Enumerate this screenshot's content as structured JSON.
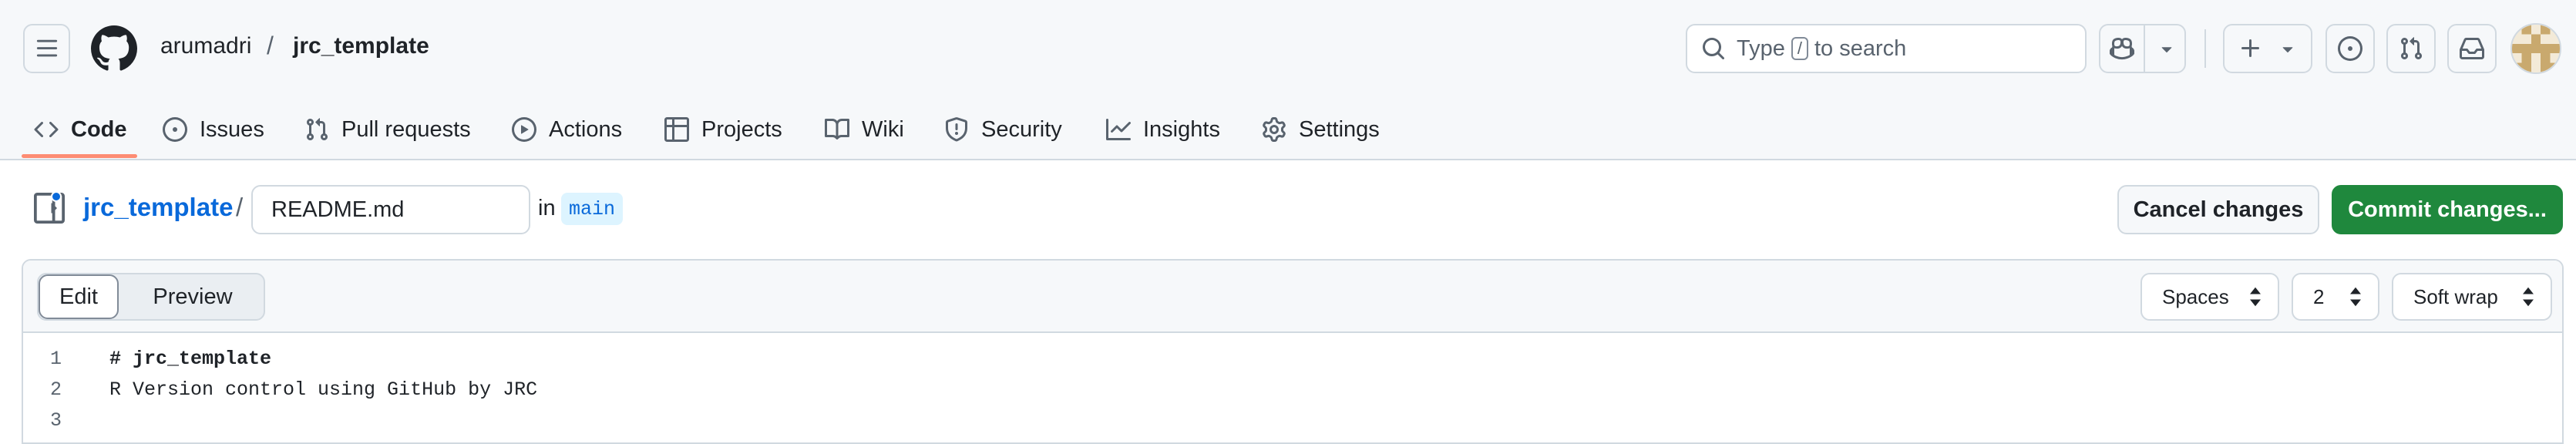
{
  "header": {
    "owner": "arumadri",
    "separator": "/",
    "repo": "jrc_template",
    "search": {
      "prefix": "Type",
      "shortcut_key": "/",
      "suffix": "to search"
    }
  },
  "tabs": [
    {
      "label": "Code",
      "icon": "code-icon"
    },
    {
      "label": "Issues",
      "icon": "issue-opened-icon"
    },
    {
      "label": "Pull requests",
      "icon": "git-pull-request-icon"
    },
    {
      "label": "Actions",
      "icon": "play-icon"
    },
    {
      "label": "Projects",
      "icon": "table-icon"
    },
    {
      "label": "Wiki",
      "icon": "book-icon"
    },
    {
      "label": "Security",
      "icon": "shield-icon"
    },
    {
      "label": "Insights",
      "icon": "graph-icon"
    },
    {
      "label": "Settings",
      "icon": "gear-icon"
    }
  ],
  "file_bar": {
    "repo_link": "jrc_template",
    "separator": "/",
    "filename": "README.md",
    "in_label": "in",
    "branch": "main",
    "cancel_label": "Cancel changes",
    "commit_label": "Commit changes..."
  },
  "editor": {
    "mode_edit": "Edit",
    "mode_preview": "Preview",
    "indent_mode": "Spaces",
    "indent_size": "2",
    "wrap_mode": "Soft wrap",
    "lines": [
      {
        "number": "1",
        "text": "# jrc_template"
      },
      {
        "number": "2",
        "text": "R Version control using GitHub by JRC"
      },
      {
        "number": "3",
        "text": ""
      }
    ]
  },
  "colors": {
    "accent_blue": "#0969da",
    "commit_green": "#1f883d",
    "tab_underline": "#fd8c73"
  }
}
